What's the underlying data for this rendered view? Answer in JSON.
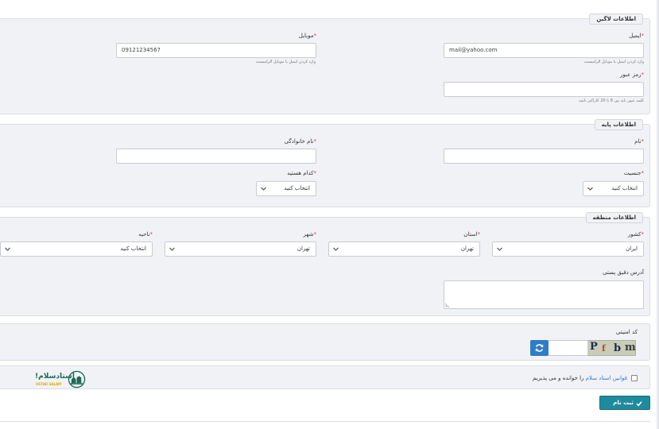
{
  "login": {
    "title": "اطلاعات لاگین",
    "email_label": "ایمیل",
    "email_value": "mail@yahoo.com",
    "email_hint": "وارد کردن ایمیل یا موبایل الزامیست",
    "mobile_label": "موبایل",
    "mobile_value": "09121234567",
    "mobile_hint": "وارد کردن ایمیل یا موبایل الزامیست",
    "password_label": "رمز عبور",
    "password_hint": "کلمه عبور باید بین 8 تا 20 کاراکتر باشد"
  },
  "basic": {
    "title": "اطلاعات پایه",
    "first_name_label": "نام",
    "last_name_label": "نام خانوادگی",
    "gender_label": "جنسیت",
    "gender_value": "انتخاب کنید",
    "which_label": "کدام هستید",
    "which_value": "انتخاب کنید"
  },
  "region": {
    "title": "اطلاعات منطقه",
    "country_label": "کشور",
    "country_value": "ایران",
    "province_label": "استان",
    "province_value": "تهران",
    "city_label": "شهر",
    "city_value": "تهران",
    "district_label": "ناحیه",
    "district_value": "انتخاب کنید",
    "address_label": "آدرس دقیق پستی"
  },
  "security": {
    "label": "کد امنیتی",
    "captcha_chars": [
      "m",
      "b",
      "f",
      "P"
    ]
  },
  "agreement": {
    "link_text": "قوانین استاد سلام",
    "suffix_text": "را خوانده و می پذیریم"
  },
  "brand": {
    "name": "استادسلام!",
    "latin": "OSTAD SALAM"
  },
  "submit_label": "ثبت نام",
  "colors": {
    "panel_bg": "#f1f2f6",
    "required": "#d43f3a",
    "link": "#2f7cc7",
    "refresh_button": "#2f7cc7",
    "submit_button": "#1f8a9e"
  },
  "icons": {
    "select_arrow": "chevron-down-icon",
    "refresh": "refresh-icon",
    "submit": "check-icon",
    "resize": "resize-grip-icon"
  }
}
